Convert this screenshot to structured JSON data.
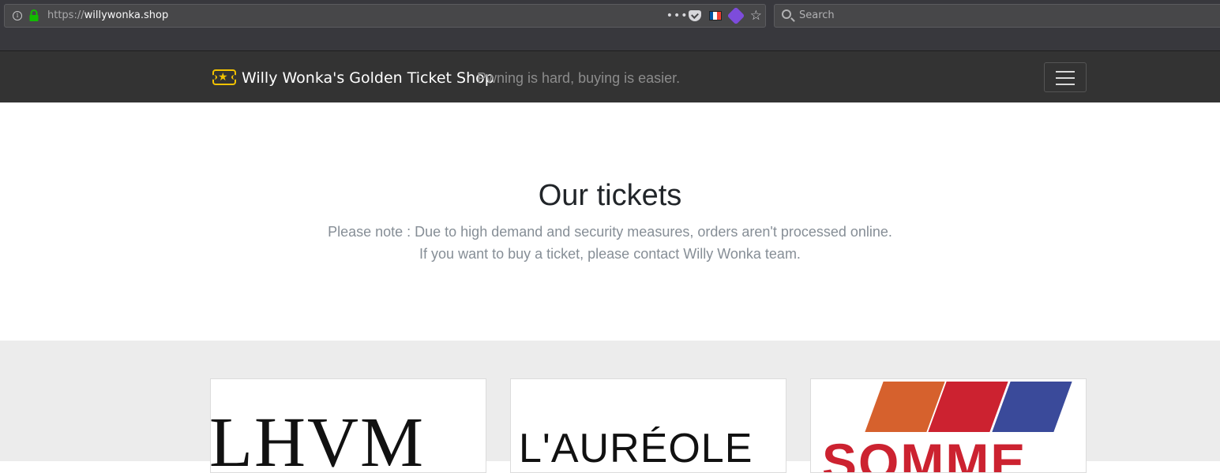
{
  "browser": {
    "url_scheme": "https://",
    "url_host": "willywonka.shop",
    "more_actions": "•••",
    "search_placeholder": "Search",
    "icons": [
      "info-icon",
      "lock-icon",
      "pocket-icon",
      "french-flag-icon",
      "extension-icon",
      "bookmark-star-icon",
      "search-icon"
    ],
    "flag_colors": [
      "#0055a4",
      "#ffffff",
      "#ef4135"
    ]
  },
  "navbar": {
    "brand_title": "Willy Wonka's Golden Ticket Shop",
    "tagline": "Pwning is hard, buying is easier.",
    "brand_icon": "golden-ticket-icon",
    "menu_icon": "hamburger-menu-icon",
    "accent_color": "#f2c200"
  },
  "hero": {
    "title": "Our tickets",
    "note_line1": "Please note : Due to high demand and security measures, orders aren't processed online.",
    "note_line2": "If you want to buy a ticket, please contact Willy Wonka team."
  },
  "tickets": [
    {
      "logo_text": "LHVM"
    },
    {
      "logo_text": "L'AURÉOLE"
    },
    {
      "logo_text": "SOMME",
      "stripe_colors": [
        "#d6612d",
        "#cc2230",
        "#3a4a9a"
      ]
    }
  ]
}
